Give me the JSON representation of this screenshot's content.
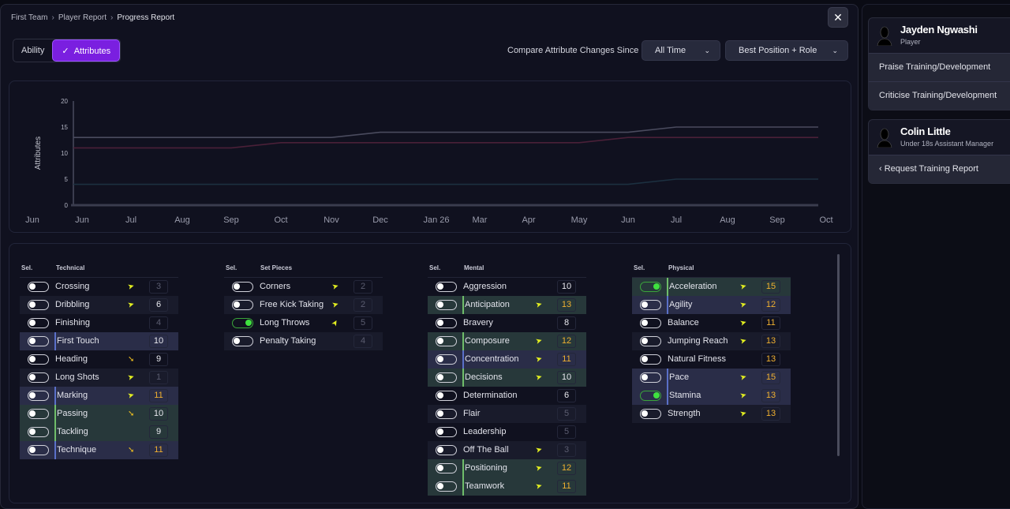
{
  "breadcrumb": [
    "First Team",
    "Player Report",
    "Progress Report"
  ],
  "close_label": "✕",
  "tabs": [
    {
      "label": "Ability"
    },
    {
      "label": "Attributes",
      "check": "✓"
    }
  ],
  "compare": {
    "label": "Compare Attribute Changes Since",
    "period": "All Time",
    "filter": "Best Position + Role"
  },
  "chart_data": {
    "type": "line",
    "ylabel": "Attributes",
    "ylim": [
      0,
      20
    ],
    "yticks": [
      0,
      5,
      10,
      15,
      20
    ],
    "x": [
      "Jun",
      "Jun",
      "Jul",
      "Aug",
      "Sep",
      "Oct",
      "Nov",
      "Dec",
      "Jan 26",
      "Mar",
      "Apr",
      "May",
      "Jun",
      "Jul",
      "Aug",
      "Sep",
      "Oct"
    ],
    "series": [
      {
        "name": "grey",
        "color": "#4a4b5e",
        "values": [
          null,
          13,
          13,
          13,
          13,
          13,
          13,
          14,
          14,
          14,
          14,
          14,
          14,
          15,
          15,
          15,
          15
        ]
      },
      {
        "name": "red",
        "color": "#4a2038",
        "values": [
          null,
          11,
          11,
          11,
          11,
          12,
          12,
          12,
          12,
          12,
          12,
          12,
          13,
          13,
          13,
          13,
          13
        ]
      },
      {
        "name": "blue",
        "color": "#1c3040",
        "values": [
          null,
          4,
          4,
          4,
          4,
          4,
          4,
          4,
          4,
          4,
          4,
          4,
          4,
          5,
          5,
          5,
          5
        ]
      }
    ]
  },
  "sel_label": "Sel.",
  "groups": [
    {
      "title": "Technical",
      "rows": [
        {
          "name": "Crossing",
          "value": "3",
          "tone": "dim",
          "arrow": "up"
        },
        {
          "name": "Dribbling",
          "value": "6",
          "tone": "",
          "arrow": "up"
        },
        {
          "name": "Finishing",
          "value": "4",
          "tone": "dim",
          "arrow": ""
        },
        {
          "name": "First Touch",
          "value": "10",
          "tone": "",
          "arrow": "",
          "hl": "blue"
        },
        {
          "name": "Heading",
          "value": "9",
          "tone": "",
          "arrow": "down"
        },
        {
          "name": "Long Shots",
          "value": "1",
          "tone": "dim",
          "arrow": "up"
        },
        {
          "name": "Marking",
          "value": "11",
          "tone": "gold",
          "arrow": "up",
          "hl": "blue"
        },
        {
          "name": "Passing",
          "value": "10",
          "tone": "",
          "arrow": "down",
          "hl": "green"
        },
        {
          "name": "Tackling",
          "value": "9",
          "tone": "",
          "arrow": "",
          "hl": "green"
        },
        {
          "name": "Technique",
          "value": "11",
          "tone": "gold",
          "arrow": "down",
          "hl": "blue"
        }
      ]
    },
    {
      "title": "Set Pieces",
      "rows": [
        {
          "name": "Corners",
          "value": "2",
          "tone": "dim",
          "arrow": "up"
        },
        {
          "name": "Free Kick Taking",
          "value": "2",
          "tone": "dim",
          "arrow": "up"
        },
        {
          "name": "Long Throws",
          "value": "5",
          "tone": "dim",
          "arrow": "up",
          "on": true
        },
        {
          "name": "Penalty Taking",
          "value": "4",
          "tone": "dim",
          "arrow": ""
        }
      ]
    },
    {
      "title": "Mental",
      "rows": [
        {
          "name": "Aggression",
          "value": "10",
          "tone": "",
          "arrow": ""
        },
        {
          "name": "Anticipation",
          "value": "13",
          "tone": "gold",
          "arrow": "up",
          "hl": "green"
        },
        {
          "name": "Bravery",
          "value": "8",
          "tone": "",
          "arrow": ""
        },
        {
          "name": "Composure",
          "value": "12",
          "tone": "gold",
          "arrow": "up",
          "hl": "green"
        },
        {
          "name": "Concentration",
          "value": "11",
          "tone": "gold",
          "arrow": "up",
          "hl": "blue"
        },
        {
          "name": "Decisions",
          "value": "10",
          "tone": "",
          "arrow": "up",
          "hl": "green"
        },
        {
          "name": "Determination",
          "value": "6",
          "tone": "",
          "arrow": ""
        },
        {
          "name": "Flair",
          "value": "5",
          "tone": "dim",
          "arrow": ""
        },
        {
          "name": "Leadership",
          "value": "5",
          "tone": "dim",
          "arrow": ""
        },
        {
          "name": "Off The Ball",
          "value": "3",
          "tone": "dim",
          "arrow": "up"
        },
        {
          "name": "Positioning",
          "value": "12",
          "tone": "gold",
          "arrow": "up",
          "hl": "green"
        },
        {
          "name": "Teamwork",
          "value": "11",
          "tone": "gold",
          "arrow": "up",
          "hl": "green"
        }
      ]
    },
    {
      "title": "Physical",
      "rows": [
        {
          "name": "Acceleration",
          "value": "15",
          "tone": "gold",
          "arrow": "up",
          "hl": "green",
          "on": true
        },
        {
          "name": "Agility",
          "value": "12",
          "tone": "gold",
          "arrow": "up",
          "hl": "blue"
        },
        {
          "name": "Balance",
          "value": "11",
          "tone": "gold",
          "arrow": "up"
        },
        {
          "name": "Jumping Reach",
          "value": "13",
          "tone": "gold",
          "arrow": "up"
        },
        {
          "name": "Natural Fitness",
          "value": "13",
          "tone": "gold",
          "arrow": ""
        },
        {
          "name": "Pace",
          "value": "15",
          "tone": "gold",
          "arrow": "up",
          "hl": "blue"
        },
        {
          "name": "Stamina",
          "value": "13",
          "tone": "gold",
          "arrow": "up",
          "hl": "blue",
          "on": true
        },
        {
          "name": "Strength",
          "value": "13",
          "tone": "gold",
          "arrow": "up"
        }
      ]
    }
  ],
  "player": {
    "name": "Jayden Ngwashi",
    "role": "Player",
    "actions": [
      "Praise Training/Development",
      "Criticise Training/Development"
    ]
  },
  "staff": {
    "name": "Colin Little",
    "role": "Under 18s Assistant Manager",
    "action": "‹ Request Training Report"
  }
}
